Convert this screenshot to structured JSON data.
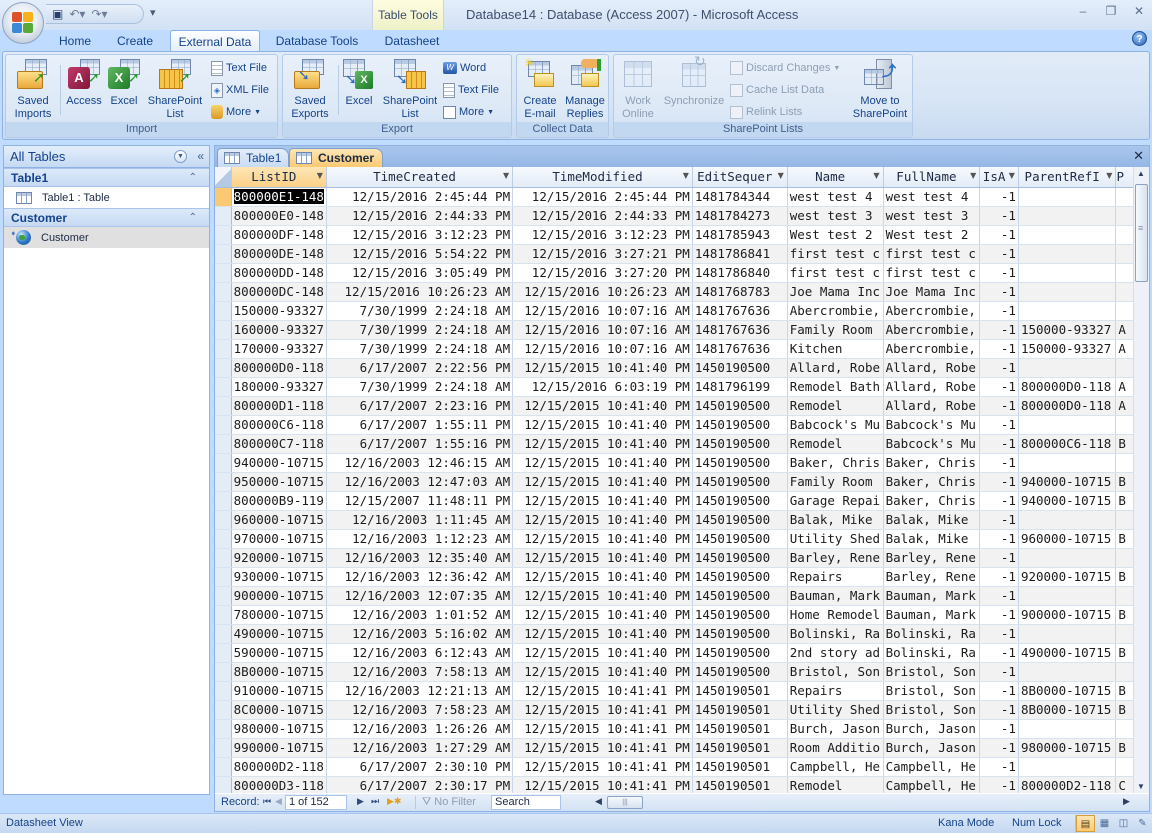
{
  "window": {
    "title": "Database14 : Database (Access 2007) - Microsoft Access",
    "contextual_tab_group": "Table Tools",
    "controls": {
      "minimize": "–",
      "restore": "❐",
      "close": "✕"
    }
  },
  "quick_access": {
    "save": "save-icon",
    "undo": "undo-icon",
    "redo": "redo-icon",
    "customize": "▾"
  },
  "ribbon": {
    "tabs": [
      {
        "label": "Home"
      },
      {
        "label": "Create"
      },
      {
        "label": "External Data",
        "active": true
      },
      {
        "label": "Database Tools"
      },
      {
        "label": "Datasheet"
      }
    ],
    "help": "?",
    "groups": {
      "import": {
        "label": "Import",
        "saved_imports": "Saved Imports",
        "access": "Access",
        "excel": "Excel",
        "sharepoint_list": "SharePoint List",
        "text_file": "Text File",
        "xml_file": "XML File",
        "more": "More"
      },
      "export": {
        "label": "Export",
        "saved_exports": "Saved Exports",
        "excel": "Excel",
        "sharepoint_list": "SharePoint List",
        "word": "Word",
        "text_file": "Text File",
        "more": "More"
      },
      "collect": {
        "label": "Collect Data",
        "create_email": "Create E-mail",
        "manage_replies": "Manage Replies"
      },
      "sharepoint": {
        "label": "SharePoint Lists",
        "work_online": "Work Online",
        "synchronize": "Synchronize",
        "discard_changes": "Discard Changes",
        "cache_list_data": "Cache List Data",
        "relink_lists": "Relink Lists",
        "move_to_sharepoint": "Move to SharePoint"
      }
    }
  },
  "nav_pane": {
    "header": "All Tables",
    "groups": [
      {
        "label": "Table1",
        "items": [
          {
            "label": "Table1 : Table",
            "icon": "table-icon"
          }
        ]
      },
      {
        "label": "Customer",
        "items": [
          {
            "label": "Customer",
            "icon": "linked-table-globe-icon",
            "selected": true
          }
        ]
      }
    ]
  },
  "doc_tabs": [
    {
      "label": "Table1",
      "active": false
    },
    {
      "label": "Customer",
      "active": true
    }
  ],
  "datasheet": {
    "columns": [
      "ListID",
      "TimeCreated",
      "TimeModified",
      "EditSequer",
      "Name",
      "FullName",
      "IsA",
      "ParentRefI",
      "P"
    ],
    "rows": [
      [
        "800000E1-148",
        "12/15/2016 2:45:44 PM",
        "12/15/2016 2:45:44 PM",
        "1481784344",
        "west test 4",
        "west test 4",
        "-1",
        "",
        ""
      ],
      [
        "800000E0-148",
        "12/15/2016 2:44:33 PM",
        "12/15/2016 2:44:33 PM",
        "1481784273",
        "west test 3",
        "west test 3",
        "-1",
        "",
        ""
      ],
      [
        "800000DF-148",
        "12/15/2016 3:12:23 PM",
        "12/15/2016 3:12:23 PM",
        "1481785943",
        "West test 2",
        "West test 2",
        "-1",
        "",
        ""
      ],
      [
        "800000DE-148",
        "12/15/2016 5:54:22 PM",
        "12/15/2016 3:27:21 PM",
        "1481786841",
        "first test c",
        "first test c",
        "-1",
        "",
        ""
      ],
      [
        "800000DD-148",
        "12/15/2016 3:05:49 PM",
        "12/15/2016 3:27:20 PM",
        "1481786840",
        "first test c",
        "first test c",
        "-1",
        "",
        ""
      ],
      [
        "800000DC-148",
        "12/15/2016 10:26:23 AM",
        "12/15/2016 10:26:23 AM",
        "1481768783",
        "Joe Mama Inc",
        "Joe Mama Inc",
        "-1",
        "",
        ""
      ],
      [
        "150000-93327",
        "7/30/1999 2:24:18 AM",
        "12/15/2016 10:07:16 AM",
        "1481767636",
        "Abercrombie,",
        "Abercrombie,",
        "-1",
        "",
        ""
      ],
      [
        "160000-93327",
        "7/30/1999 2:24:18 AM",
        "12/15/2016 10:07:16 AM",
        "1481767636",
        "Family Room",
        "Abercrombie,",
        "-1",
        "150000-93327",
        "A"
      ],
      [
        "170000-93327",
        "7/30/1999 2:24:18 AM",
        "12/15/2016 10:07:16 AM",
        "1481767636",
        "Kitchen",
        "Abercrombie,",
        "-1",
        "150000-93327",
        "A"
      ],
      [
        "800000D0-118",
        "6/17/2007 2:22:56 PM",
        "12/15/2015 10:41:40 PM",
        "1450190500",
        "Allard, Robe",
        "Allard, Robe",
        "-1",
        "",
        ""
      ],
      [
        "180000-93327",
        "7/30/1999 2:24:18 AM",
        "12/15/2016 6:03:19 PM",
        "1481796199",
        "Remodel Bath",
        "Allard, Robe",
        "-1",
        "800000D0-118",
        "A"
      ],
      [
        "800000D1-118",
        "6/17/2007 2:23:16 PM",
        "12/15/2015 10:41:40 PM",
        "1450190500",
        "Remodel",
        "Allard, Robe",
        "-1",
        "800000D0-118",
        "A"
      ],
      [
        "800000C6-118",
        "6/17/2007 1:55:11 PM",
        "12/15/2015 10:41:40 PM",
        "1450190500",
        "Babcock's Mu",
        "Babcock's Mu",
        "-1",
        "",
        ""
      ],
      [
        "800000C7-118",
        "6/17/2007 1:55:16 PM",
        "12/15/2015 10:41:40 PM",
        "1450190500",
        "Remodel",
        "Babcock's Mu",
        "-1",
        "800000C6-118",
        "B"
      ],
      [
        "940000-10715",
        "12/16/2003 12:46:15 AM",
        "12/15/2015 10:41:40 PM",
        "1450190500",
        "Baker, Chris",
        "Baker, Chris",
        "-1",
        "",
        ""
      ],
      [
        "950000-10715",
        "12/16/2003 12:47:03 AM",
        "12/15/2015 10:41:40 PM",
        "1450190500",
        "Family Room",
        "Baker, Chris",
        "-1",
        "940000-10715",
        "B"
      ],
      [
        "800000B9-119",
        "12/15/2007 11:48:11 PM",
        "12/15/2015 10:41:40 PM",
        "1450190500",
        "Garage Repai",
        "Baker, Chris",
        "-1",
        "940000-10715",
        "B"
      ],
      [
        "960000-10715",
        "12/16/2003 1:11:45 AM",
        "12/15/2015 10:41:40 PM",
        "1450190500",
        "Balak, Mike",
        "Balak, Mike",
        "-1",
        "",
        ""
      ],
      [
        "970000-10715",
        "12/16/2003 1:12:23 AM",
        "12/15/2015 10:41:40 PM",
        "1450190500",
        "Utility Shed",
        "Balak, Mike",
        "-1",
        "960000-10715",
        "B"
      ],
      [
        "920000-10715",
        "12/16/2003 12:35:40 AM",
        "12/15/2015 10:41:40 PM",
        "1450190500",
        "Barley, Rene",
        "Barley, Rene",
        "-1",
        "",
        ""
      ],
      [
        "930000-10715",
        "12/16/2003 12:36:42 AM",
        "12/15/2015 10:41:40 PM",
        "1450190500",
        "Repairs",
        "Barley, Rene",
        "-1",
        "920000-10715",
        "B"
      ],
      [
        "900000-10715",
        "12/16/2003 12:07:35 AM",
        "12/15/2015 10:41:40 PM",
        "1450190500",
        "Bauman, Mark",
        "Bauman, Mark",
        "-1",
        "",
        ""
      ],
      [
        "780000-10715",
        "12/16/2003 1:01:52 AM",
        "12/15/2015 10:41:40 PM",
        "1450190500",
        "Home Remodel",
        "Bauman, Mark",
        "-1",
        "900000-10715",
        "B"
      ],
      [
        "490000-10715",
        "12/16/2003 5:16:02 AM",
        "12/15/2015 10:41:40 PM",
        "1450190500",
        "Bolinski, Ra",
        "Bolinski, Ra",
        "-1",
        "",
        ""
      ],
      [
        "590000-10715",
        "12/16/2003 6:12:43 AM",
        "12/15/2015 10:41:40 PM",
        "1450190500",
        "2nd story ad",
        "Bolinski, Ra",
        "-1",
        "490000-10715",
        "B"
      ],
      [
        "8B0000-10715",
        "12/16/2003 7:58:13 AM",
        "12/15/2015 10:41:40 PM",
        "1450190500",
        "Bristol, Son",
        "Bristol, Son",
        "-1",
        "",
        ""
      ],
      [
        "910000-10715",
        "12/16/2003 12:21:13 AM",
        "12/15/2015 10:41:41 PM",
        "1450190501",
        "Repairs",
        "Bristol, Son",
        "-1",
        "8B0000-10715",
        "B"
      ],
      [
        "8C0000-10715",
        "12/16/2003 7:58:23 AM",
        "12/15/2015 10:41:41 PM",
        "1450190501",
        "Utility Shed",
        "Bristol, Son",
        "-1",
        "8B0000-10715",
        "B"
      ],
      [
        "980000-10715",
        "12/16/2003 1:26:26 AM",
        "12/15/2015 10:41:41 PM",
        "1450190501",
        "Burch, Jason",
        "Burch, Jason",
        "-1",
        "",
        ""
      ],
      [
        "990000-10715",
        "12/16/2003 1:27:29 AM",
        "12/15/2015 10:41:41 PM",
        "1450190501",
        "Room Additio",
        "Burch, Jason",
        "-1",
        "980000-10715",
        "B"
      ],
      [
        "800000D2-118",
        "6/17/2007 2:30:10 PM",
        "12/15/2015 10:41:41 PM",
        "1450190501",
        "Campbell, He",
        "Campbell, He",
        "-1",
        "",
        ""
      ],
      [
        "800000D3-118",
        "6/17/2007 2:30:17 PM",
        "12/15/2015 10:41:41 PM",
        "1450190501",
        "Remodel",
        "Campbell, He",
        "-1",
        "800000D2-118",
        "C"
      ]
    ]
  },
  "record_nav": {
    "label": "Record:",
    "current": "1 of 152",
    "filter": "No Filter",
    "search_placeholder": "Search"
  },
  "status_bar": {
    "view": "Datasheet View",
    "kana_mode": "Kana Mode",
    "num_lock": "Num Lock"
  },
  "colors": {
    "accent": "#15428b",
    "active_tab": "#fbc973",
    "ribbon_bg": "#bfdbff"
  }
}
